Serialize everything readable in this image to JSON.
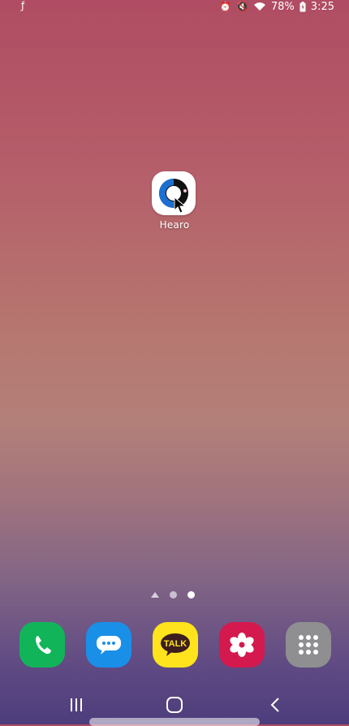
{
  "status_bar": {
    "battery_percent": "78%",
    "time": "3:25",
    "icons": [
      "notification-f-icon",
      "alarm-icon",
      "mute-icon",
      "wifi-icon",
      "battery-charging-icon"
    ]
  },
  "home_screen": {
    "apps": [
      {
        "label": "Hearo",
        "icon": "hearo-app-icon"
      }
    ],
    "pages": {
      "count": 3,
      "current": 3,
      "first_is_home": true
    }
  },
  "dock": {
    "apps": [
      {
        "name": "phone",
        "icon": "phone-icon",
        "color": "#12b45a"
      },
      {
        "name": "messages",
        "icon": "chat-bubble-icon",
        "color": "#1a8fe8"
      },
      {
        "name": "kakaotalk",
        "icon": "talk-bubble-icon",
        "color": "#ffe31c",
        "text": "TALK"
      },
      {
        "name": "gallery",
        "icon": "flower-icon",
        "color": "#d4194f"
      },
      {
        "name": "apps",
        "icon": "app-grid-icon",
        "color": "#8f8f91"
      }
    ]
  },
  "nav_bar": {
    "buttons": [
      "recent-apps",
      "home",
      "back"
    ]
  }
}
